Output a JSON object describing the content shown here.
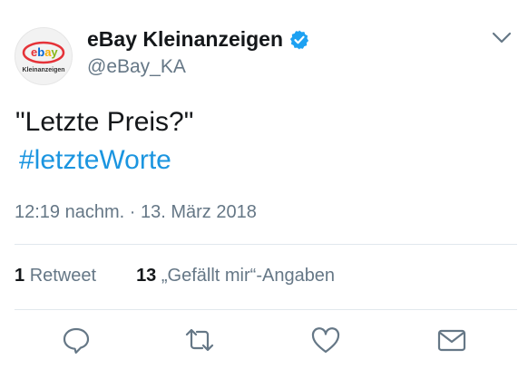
{
  "author": {
    "display_name": "eBay Kleinanzeigen",
    "handle": "@eBay_KA",
    "verified": true,
    "avatar": {
      "logo_text": "ebay",
      "subtext": "Kleinanzeigen",
      "colors": {
        "red": "#e53238",
        "blue": "#0064d2",
        "yellow": "#f5af02",
        "green": "#86b817"
      }
    }
  },
  "tweet": {
    "text": "\"Letzte Preis?\"",
    "hashtag": "#letzteWorte",
    "timestamp": "12:19 nachm. · 13. März 2018"
  },
  "stats": {
    "retweets_count": "1",
    "retweets_label": "Retweet",
    "likes_count": "13",
    "likes_label": "„Gefällt mir“-Angaben"
  },
  "actions": [
    {
      "name": "reply",
      "icon": "reply-icon"
    },
    {
      "name": "retweet",
      "icon": "retweet-icon"
    },
    {
      "name": "like",
      "icon": "heart-icon"
    },
    {
      "name": "direct-message",
      "icon": "envelope-icon"
    }
  ],
  "colors": {
    "text_primary": "#14171a",
    "text_secondary": "#657786",
    "link": "#1b95e0",
    "verified": "#1da1f2",
    "divider": "#e1e8ed"
  }
}
